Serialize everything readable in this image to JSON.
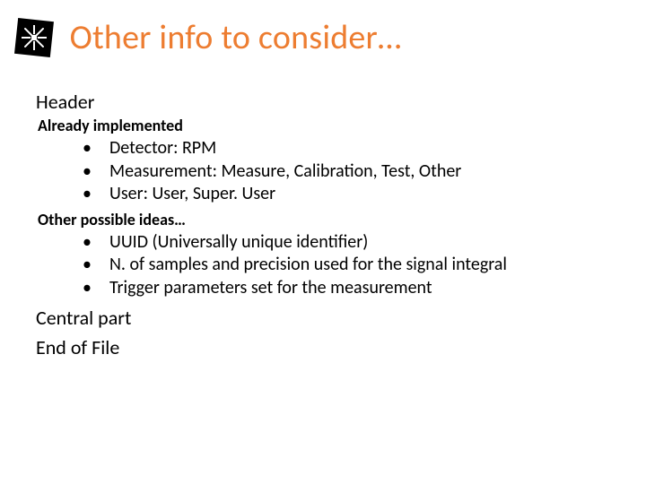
{
  "title": "Other info to consider…",
  "header_label": "Header",
  "already_label": "Already implemented",
  "already_items": [
    "Detector: RPM",
    "Measurement: Measure, Calibration, Test, Other",
    "User: User, Super. User"
  ],
  "ideas_label": "Other possible ideas…",
  "ideas_items": [
    "UUID (Universally unique identifier)",
    "N. of samples and precision used for the signal integral",
    "Trigger parameters set for the measurement"
  ],
  "central_label": "Central part",
  "eof_label": "End of File"
}
